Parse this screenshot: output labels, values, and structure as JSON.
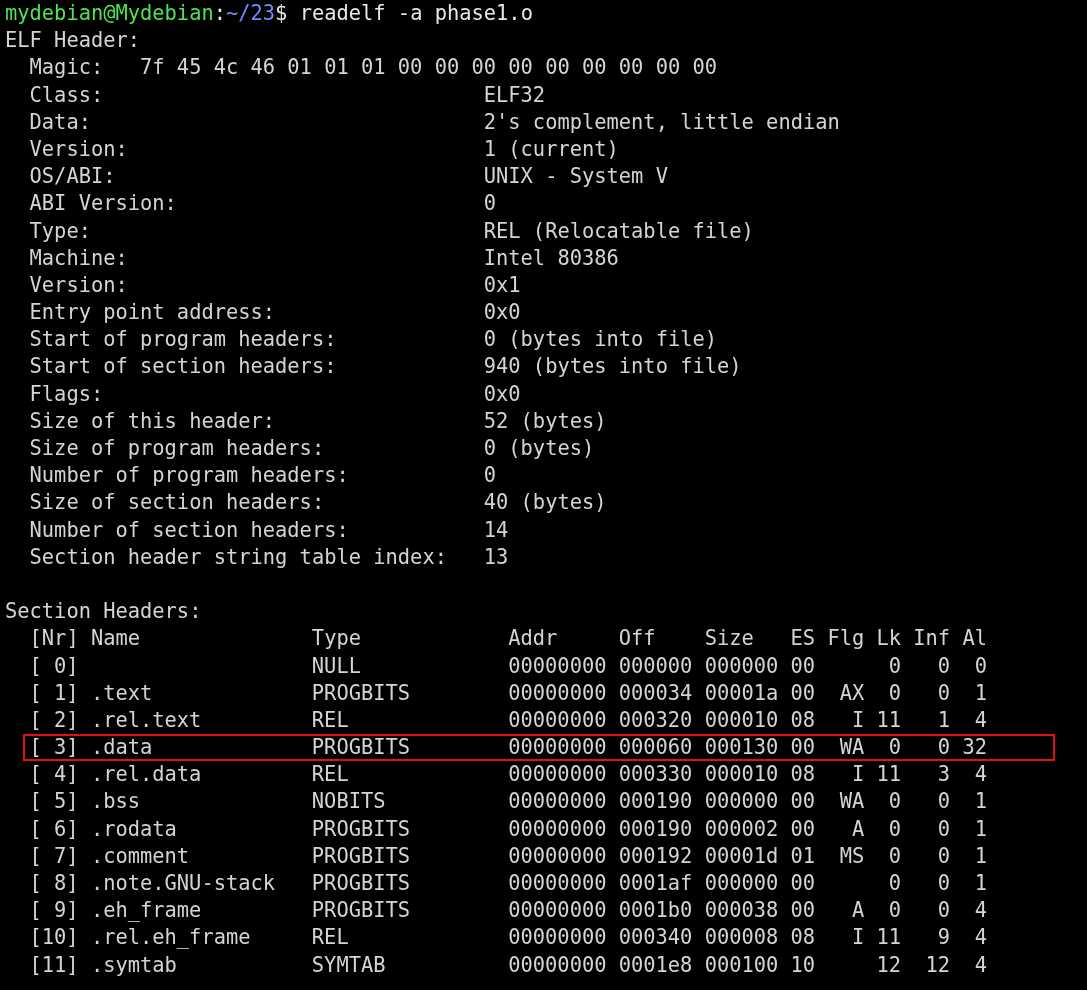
{
  "prompt": {
    "user_host": "mydebian@Mydebian",
    "separator": ":",
    "path": "~/23",
    "symbol": "$",
    "command": "readelf -a phase1.o"
  },
  "elf_header": {
    "title": "ELF Header:",
    "fields": [
      {
        "kind": "magic",
        "label": "Magic:",
        "value": "7f 45 4c 46 01 01 01 00 00 00 00 00 00 00 00 00"
      },
      {
        "kind": "field",
        "label": "Class:",
        "value": "ELF32"
      },
      {
        "kind": "field",
        "label": "Data:",
        "value": "2's complement, little endian"
      },
      {
        "kind": "field",
        "label": "Version:",
        "value": "1 (current)"
      },
      {
        "kind": "field",
        "label": "OS/ABI:",
        "value": "UNIX - System V"
      },
      {
        "kind": "field",
        "label": "ABI Version:",
        "value": "0"
      },
      {
        "kind": "field",
        "label": "Type:",
        "value": "REL (Relocatable file)"
      },
      {
        "kind": "field",
        "label": "Machine:",
        "value": "Intel 80386"
      },
      {
        "kind": "field",
        "label": "Version:",
        "value": "0x1"
      },
      {
        "kind": "field",
        "label": "Entry point address:",
        "value": "0x0"
      },
      {
        "kind": "field",
        "label": "Start of program headers:",
        "value": "0 (bytes into file)"
      },
      {
        "kind": "field",
        "label": "Start of section headers:",
        "value": "940 (bytes into file)"
      },
      {
        "kind": "field",
        "label": "Flags:",
        "value": "0x0"
      },
      {
        "kind": "field",
        "label": "Size of this header:",
        "value": "52 (bytes)"
      },
      {
        "kind": "field",
        "label": "Size of program headers:",
        "value": "0 (bytes)"
      },
      {
        "kind": "field",
        "label": "Number of program headers:",
        "value": "0"
      },
      {
        "kind": "field",
        "label": "Size of section headers:",
        "value": "40 (bytes)"
      },
      {
        "kind": "field",
        "label": "Number of section headers:",
        "value": "14"
      },
      {
        "kind": "field",
        "label": "Section header string table index:",
        "value": "13"
      }
    ]
  },
  "section_headers": {
    "title": "Section Headers:",
    "columns": [
      "[Nr]",
      "Name",
      "Type",
      "Addr",
      "Off",
      "Size",
      "ES",
      "Flg",
      "Lk",
      "Inf",
      "Al"
    ],
    "rows": [
      {
        "nr": "[ 0]",
        "type": "NULL",
        "addr": "00000000",
        "off": "000000",
        "size": "000000",
        "es": "00",
        "lk": "0",
        "inf": "0",
        "al": "0",
        "highlighted": false
      },
      {
        "nr": "[ 1]",
        "name": ".text",
        "type": "PROGBITS",
        "addr": "00000000",
        "off": "000034",
        "size": "00001a",
        "es": "00",
        "flg": "AX",
        "lk": "0",
        "inf": "0",
        "al": "1",
        "highlighted": false
      },
      {
        "nr": "[ 2]",
        "name": ".rel.text",
        "type": "REL",
        "addr": "00000000",
        "off": "000320",
        "size": "000010",
        "es": "08",
        "flg": "I",
        "lk": "11",
        "inf": "1",
        "al": "4",
        "highlighted": false
      },
      {
        "nr": "[ 3]",
        "name": ".data",
        "type": "PROGBITS",
        "addr": "00000000",
        "off": "000060",
        "size": "000130",
        "es": "00",
        "flg": "WA",
        "lk": "0",
        "inf": "0",
        "al": "32",
        "highlighted": true
      },
      {
        "nr": "[ 4]",
        "name": ".rel.data",
        "type": "REL",
        "addr": "00000000",
        "off": "000330",
        "size": "000010",
        "es": "08",
        "flg": "I",
        "lk": "11",
        "inf": "3",
        "al": "4",
        "highlighted": false
      },
      {
        "nr": "[ 5]",
        "name": ".bss",
        "type": "NOBITS",
        "addr": "00000000",
        "off": "000190",
        "size": "000000",
        "es": "00",
        "flg": "WA",
        "lk": "0",
        "inf": "0",
        "al": "1",
        "highlighted": false
      },
      {
        "nr": "[ 6]",
        "name": ".rodata",
        "type": "PROGBITS",
        "addr": "00000000",
        "off": "000190",
        "size": "000002",
        "es": "00",
        "flg": "A",
        "lk": "0",
        "inf": "0",
        "al": "1",
        "highlighted": false
      },
      {
        "nr": "[ 7]",
        "name": ".comment",
        "type": "PROGBITS",
        "addr": "00000000",
        "off": "000192",
        "size": "00001d",
        "es": "01",
        "flg": "MS",
        "lk": "0",
        "inf": "0",
        "al": "1",
        "highlighted": false
      },
      {
        "nr": "[ 8]",
        "name": ".note.GNU-stack",
        "type": "PROGBITS",
        "addr": "00000000",
        "off": "0001af",
        "size": "000000",
        "es": "00",
        "lk": "0",
        "inf": "0",
        "al": "1",
        "highlighted": false
      },
      {
        "nr": "[ 9]",
        "name": ".eh_frame",
        "type": "PROGBITS",
        "addr": "00000000",
        "off": "0001b0",
        "size": "000038",
        "es": "00",
        "flg": "A",
        "lk": "0",
        "inf": "0",
        "al": "4",
        "highlighted": false
      },
      {
        "nr": "[10]",
        "name": ".rel.eh_frame",
        "type": "REL",
        "addr": "00000000",
        "off": "000340",
        "size": "000008",
        "es": "08",
        "flg": "I",
        "lk": "11",
        "inf": "9",
        "al": "4",
        "highlighted": false
      },
      {
        "nr": "[11]",
        "name": ".symtab",
        "type": "SYMTAB",
        "addr": "00000000",
        "off": "0001e8",
        "size": "000100",
        "es": "10",
        "lk": "12",
        "inf": "12",
        "al": "4",
        "highlighted": false
      }
    ]
  }
}
